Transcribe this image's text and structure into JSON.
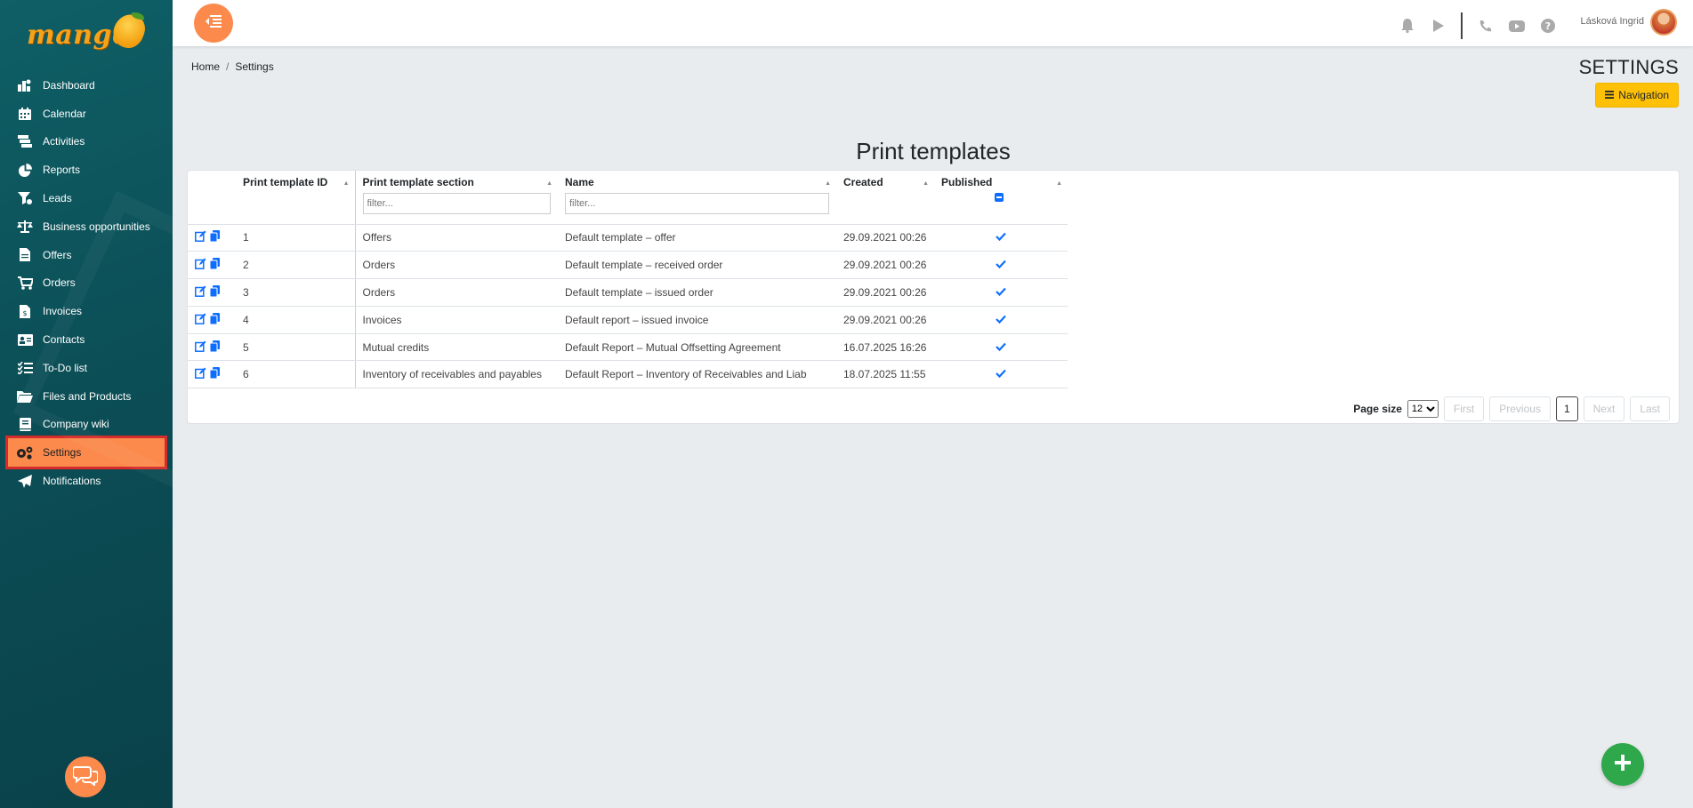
{
  "app": {
    "logo_text": "mango"
  },
  "sidebar": {
    "items": [
      {
        "label": "Dashboard",
        "icon": "dashboard-icon"
      },
      {
        "label": "Calendar",
        "icon": "calendar-icon"
      },
      {
        "label": "Activities",
        "icon": "activities-icon"
      },
      {
        "label": "Reports",
        "icon": "pie-chart-icon"
      },
      {
        "label": "Leads",
        "icon": "funnel-icon"
      },
      {
        "label": "Business opportunities",
        "icon": "scales-icon"
      },
      {
        "label": "Offers",
        "icon": "document-icon"
      },
      {
        "label": "Orders",
        "icon": "cart-icon"
      },
      {
        "label": "Invoices",
        "icon": "invoice-icon"
      },
      {
        "label": "Contacts",
        "icon": "contact-card-icon"
      },
      {
        "label": "To-Do list",
        "icon": "checklist-icon"
      },
      {
        "label": "Files and Products",
        "icon": "folder-icon"
      },
      {
        "label": "Company wiki",
        "icon": "book-icon"
      },
      {
        "label": "Settings",
        "icon": "gears-icon",
        "active": true
      },
      {
        "label": "Notifications",
        "icon": "paper-plane-icon"
      }
    ]
  },
  "topbar": {
    "user_name": "Lásková Ingrid"
  },
  "breadcrumb": {
    "home": "Home",
    "separator": "/",
    "current": "Settings"
  },
  "page": {
    "heading": "SETTINGS",
    "nav_button": "Navigation",
    "section_title": "Print templates"
  },
  "table": {
    "columns": {
      "id": "Print template ID",
      "section": "Print template section",
      "name": "Name",
      "created": "Created",
      "published": "Published"
    },
    "filter_placeholder": "filter...",
    "rows": [
      {
        "id": "1",
        "section": "Offers",
        "name": "Default template – offer",
        "created": "29.09.2021 00:26"
      },
      {
        "id": "2",
        "section": "Orders",
        "name": "Default template – received order",
        "created": "29.09.2021 00:26"
      },
      {
        "id": "3",
        "section": "Orders",
        "name": "Default template – issued order",
        "created": "29.09.2021 00:26"
      },
      {
        "id": "4",
        "section": "Invoices",
        "name": "Default report – issued invoice",
        "created": "29.09.2021 00:26"
      },
      {
        "id": "5",
        "section": "Mutual credits",
        "name": "Default Report – Mutual Offsetting Agreement",
        "created": "16.07.2025 16:26"
      },
      {
        "id": "6",
        "section": "Inventory of receivables and payables",
        "name": "Default Report – Inventory of Receivables and Liab",
        "created": "18.07.2025 11:55"
      }
    ]
  },
  "pager": {
    "page_size_label": "Page size",
    "page_size": "12",
    "first": "First",
    "previous": "Previous",
    "current": "1",
    "next": "Next",
    "last": "Last"
  },
  "colors": {
    "accent": "#fb8a4c",
    "sidebar": "#0c4f57",
    "primary": "#0d6efd",
    "success": "#2ea84a",
    "warning": "#ffc107"
  }
}
